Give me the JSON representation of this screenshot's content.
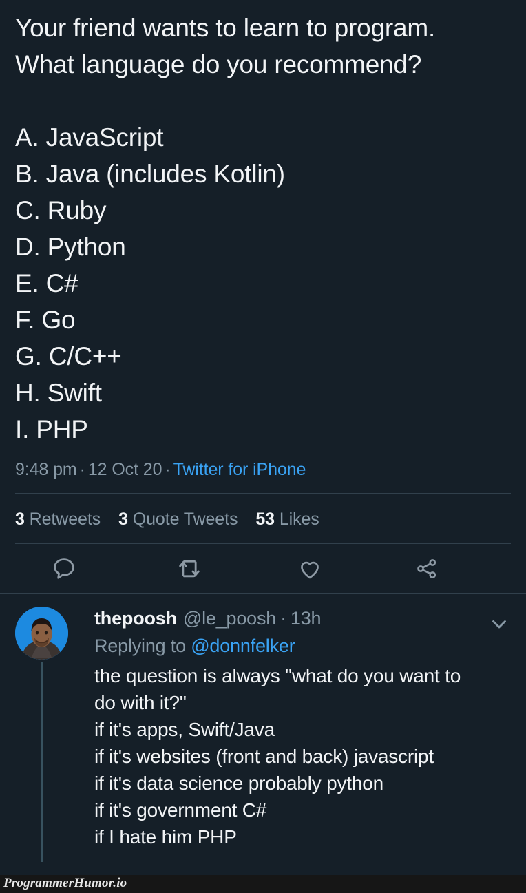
{
  "theme": {
    "background": "#151f28",
    "text_primary": "#f2f4f6",
    "text_secondary": "#8899a6",
    "link": "#3aa3f4",
    "divider": "#31404c",
    "thread_line": "#38525f",
    "avatar_background": "#1d8ae0",
    "watermark_band": "#161616"
  },
  "tweet": {
    "text_line_1": "Your friend wants to learn to program.",
    "text_line_2": "What language do you recommend?",
    "poll_options": [
      "A. JavaScript",
      "B. Java (includes Kotlin)",
      "C. Ruby",
      "D. Python",
      "E. C#",
      "F. Go",
      "G. C/C++",
      "H. Swift",
      "I. PHP"
    ],
    "meta": {
      "time": "9:48 pm",
      "separator_1": "·",
      "date": "12 Oct 20",
      "separator_2": "·",
      "source": "Twitter for iPhone"
    },
    "stats": [
      {
        "count": "3",
        "label": "Retweets"
      },
      {
        "count": "3",
        "label": "Quote Tweets"
      },
      {
        "count": "53",
        "label": "Likes"
      }
    ],
    "actions": [
      {
        "icon": "reply-icon",
        "label": "Reply"
      },
      {
        "icon": "retweet-icon",
        "label": "Retweet"
      },
      {
        "icon": "like-icon",
        "label": "Like"
      },
      {
        "icon": "share-icon",
        "label": "Share"
      }
    ]
  },
  "reply": {
    "display_name": "thepoosh",
    "handle": "@le_poosh",
    "dot": "·",
    "timestamp": "13h",
    "replying_to_prefix": "Replying to",
    "replying_to_mention": "@donnfelker",
    "caret_icon": "chevron-down-icon",
    "avatar_icon": "user-avatar",
    "body_lines": [
      "the question is always \"what do you want to",
      "do with it?\"",
      "if it's apps, Swift/Java",
      "if it's websites (front and back) javascript",
      "if it's data science probably python",
      "if it's government C#",
      "if I hate him PHP"
    ]
  },
  "watermark": {
    "text": "ProgrammerHumor.io"
  }
}
